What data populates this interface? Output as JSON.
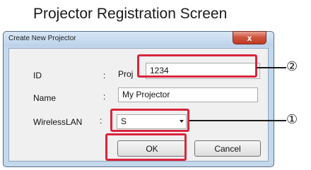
{
  "page": {
    "title": "Projector Registration Screen"
  },
  "dialog": {
    "title": "Create New Projector",
    "close_glyph": "x",
    "fields": {
      "id": {
        "label": "ID",
        "colon": ":",
        "hidden_prefix": "Proj",
        "value": "1234"
      },
      "name": {
        "label": "Name",
        "colon": ":",
        "value": "My Projector"
      },
      "wireless": {
        "label": "WirelessLAN",
        "colon": ":",
        "selected": "S"
      }
    },
    "buttons": {
      "ok": "OK",
      "cancel": "Cancel"
    }
  },
  "callouts": {
    "one": "①",
    "two": "②"
  },
  "colors": {
    "highlight": "#d8263c",
    "close_button": "#c13b25",
    "window_frame": "#c4d8ec"
  }
}
